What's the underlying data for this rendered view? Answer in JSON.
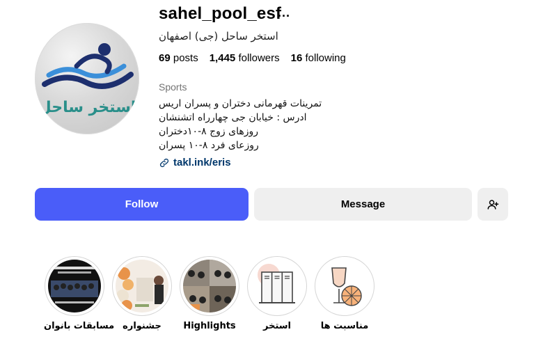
{
  "profile": {
    "username": "sahel_pool_esf",
    "more_icon": "more-horizontal-icon",
    "full_name": "استخر ساحل (جی) اصفهان",
    "avatar_text": "استخر ساحل",
    "stats": {
      "posts_count": "69",
      "posts_label": "posts",
      "followers_count": "1,445",
      "followers_label": "followers",
      "following_count": "16",
      "following_label": "following"
    },
    "category": "Sports",
    "bio": [
      "تمرینات قهرمانی دختران و پسران اریس",
      "ادرس : خیابان جی چهارراه اتشنشان",
      "روزهای زوج ۸-۱۰دختران",
      "روزعای فرد ۸-۱۰ پسران"
    ],
    "link": {
      "icon": "link-icon",
      "text": "takl.ink/eris"
    }
  },
  "actions": {
    "follow_label": "Follow",
    "message_label": "Message",
    "add_user_icon": "person-add-icon"
  },
  "highlights": [
    {
      "label": "مسابقات بانوان"
    },
    {
      "label": "جشنواره"
    },
    {
      "label": "Highlights"
    },
    {
      "label": "استخر"
    },
    {
      "label": "مناسبت ها"
    }
  ],
  "colors": {
    "follow_button": "#4a5df9",
    "secondary_button": "#efefef",
    "link": "#00376b",
    "logo_teal": "#2a8f8a",
    "logo_navy": "#1d2f6e"
  }
}
